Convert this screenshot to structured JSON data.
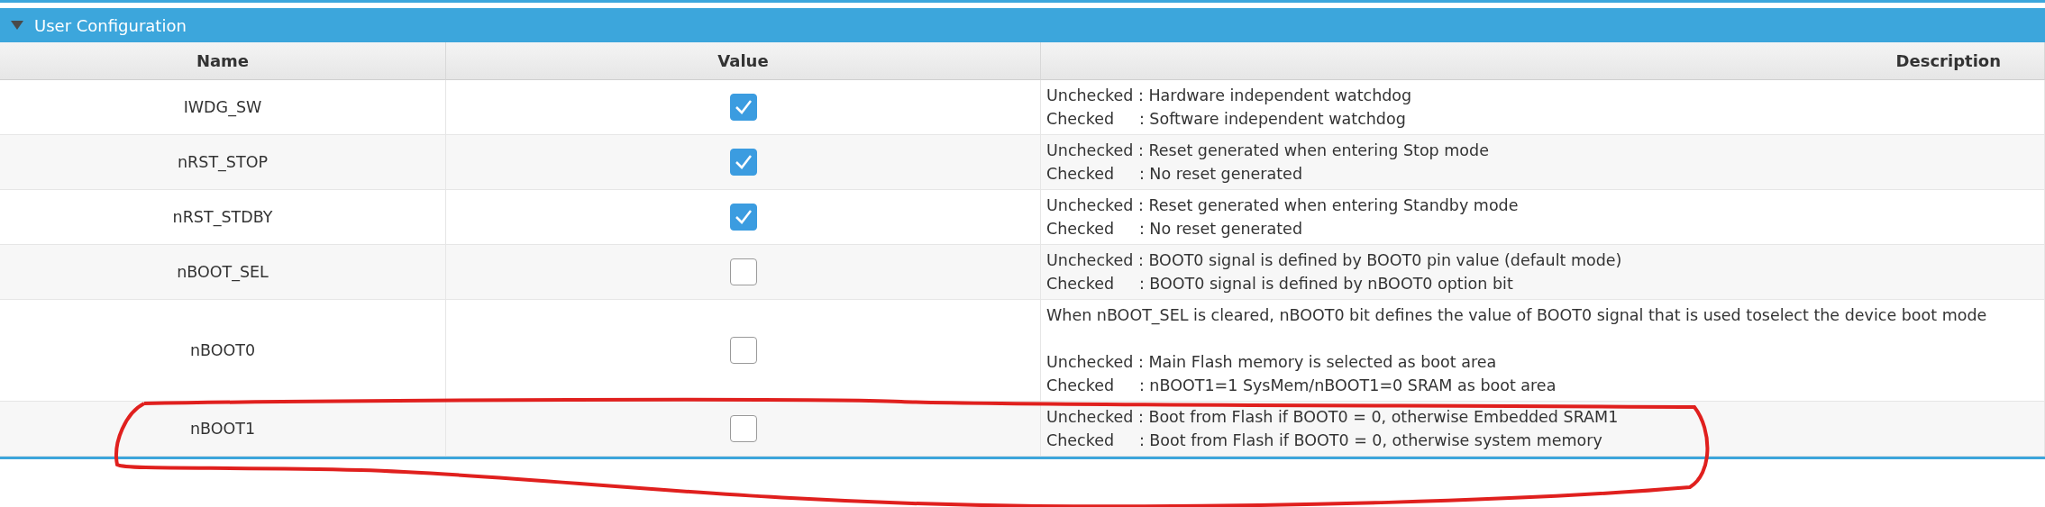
{
  "section": {
    "title": "User Configuration",
    "expanded": true
  },
  "table": {
    "columns": [
      "Name",
      "Value",
      "Description"
    ],
    "rows": [
      {
        "name": "IWDG_SW",
        "checked": true,
        "description": [
          [
            "Unchecked : Hardware independent watchdog",
            "Checked     : Software independent watchdog"
          ]
        ]
      },
      {
        "name": "nRST_STOP",
        "checked": true,
        "description": [
          [
            "Unchecked : Reset generated when entering Stop mode",
            "Checked     : No reset generated"
          ]
        ]
      },
      {
        "name": "nRST_STDBY",
        "checked": true,
        "description": [
          [
            "Unchecked : Reset generated when entering Standby mode",
            "Checked     : No reset generated"
          ]
        ]
      },
      {
        "name": "nBOOT_SEL",
        "checked": false,
        "description": [
          [
            "Unchecked : BOOT0 signal is defined by BOOT0 pin value (default mode)",
            "Checked     : BOOT0 signal is defined by nBOOT0 option bit"
          ]
        ]
      },
      {
        "name": "nBOOT0",
        "checked": false,
        "description": [
          [
            "When nBOOT_SEL is cleared, nBOOT0 bit defines the value of BOOT0 signal that is used toselect the device boot mode"
          ],
          [
            "Unchecked : Main Flash memory is selected as boot area",
            "Checked     : nBOOT1=1 SysMem/nBOOT1=0 SRAM as boot area"
          ]
        ]
      },
      {
        "name": "nBOOT1",
        "checked": false,
        "description": [
          [
            "Unchecked : Boot from Flash if BOOT0 = 0, otherwise Embedded SRAM1",
            "Checked     : Boot from Flash if BOOT0 = 0, otherwise system memory"
          ]
        ]
      }
    ]
  },
  "annotations": [
    {
      "kind": "freehand-loop",
      "color": "#e0201e"
    }
  ]
}
